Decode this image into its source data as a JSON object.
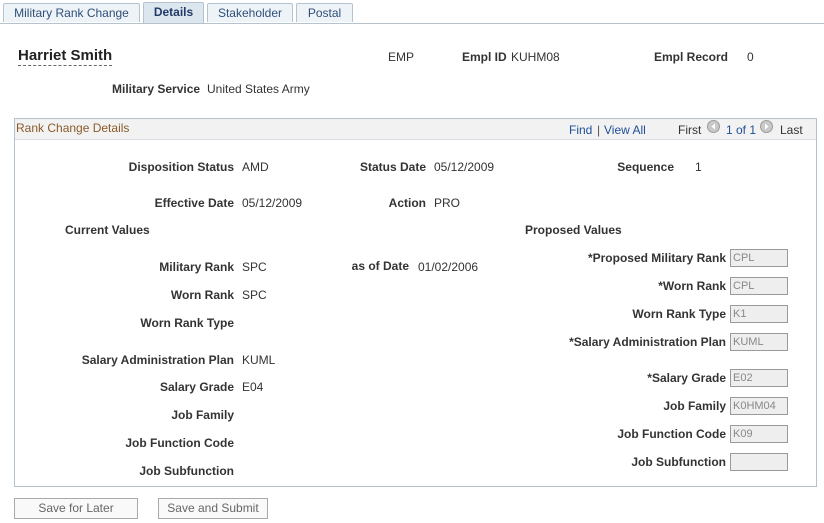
{
  "tabs": [
    {
      "label": "Military Rank Change"
    },
    {
      "label": "Details"
    },
    {
      "label": "Stakeholder"
    },
    {
      "label": "Postal"
    }
  ],
  "header": {
    "name": "Harriet Smith",
    "emp_type": "EMP",
    "empl_id_label": "Empl ID",
    "empl_id": "KUHM08",
    "empl_record_label": "Empl Record",
    "empl_record": "0",
    "military_service_label": "Military Service",
    "military_service": "United States Army"
  },
  "section": {
    "title": "Rank Change Details",
    "find_label": "Find",
    "separator": "|",
    "view_all_label": "View All",
    "first_label": "First",
    "page_indicator": "1 of 1",
    "last_label": "Last"
  },
  "details": {
    "disposition_status_label": "Disposition Status",
    "disposition_status": "AMD",
    "status_date_label": "Status Date",
    "status_date": "05/12/2009",
    "sequence_label": "Sequence",
    "sequence": "1",
    "effective_date_label": "Effective Date",
    "effective_date": "05/12/2009",
    "action_label": "Action",
    "action": "PRO"
  },
  "current": {
    "heading": "Current Values",
    "military_rank_label": "Military Rank",
    "military_rank": "SPC",
    "as_of_date_label": "as of Date",
    "as_of_date": "01/02/2006",
    "worn_rank_label": "Worn Rank",
    "worn_rank": "SPC",
    "worn_rank_type_label": "Worn Rank Type",
    "worn_rank_type": "",
    "salary_admin_plan_label": "Salary Administration Plan",
    "salary_admin_plan": "KUML",
    "salary_grade_label": "Salary Grade",
    "salary_grade": "E04",
    "job_family_label": "Job Family",
    "job_family": "",
    "job_function_code_label": "Job Function Code",
    "job_function_code": "",
    "job_subfunction_label": "Job Subfunction",
    "job_subfunction": ""
  },
  "proposed": {
    "heading": "Proposed Values",
    "military_rank_label": "*Proposed Military Rank",
    "military_rank": "CPL",
    "worn_rank_label": "*Worn Rank",
    "worn_rank": "CPL",
    "worn_rank_type_label": "Worn Rank Type",
    "worn_rank_type": "K1",
    "salary_admin_plan_label": "*Salary Administration Plan",
    "salary_admin_plan": "KUML",
    "salary_grade_label": "*Salary Grade",
    "salary_grade": "E02",
    "job_family_label": "Job Family",
    "job_family": "K0HM04",
    "job_function_code_label": "Job Function Code",
    "job_function_code": "K09",
    "job_subfunction_label": "Job Subfunction",
    "job_subfunction": ""
  },
  "buttons": {
    "save_later": "Save for Later",
    "save_submit": "Save and Submit"
  },
  "icons": {
    "prev": "circle-left-arrow-icon",
    "next": "circle-right-arrow-icon"
  }
}
